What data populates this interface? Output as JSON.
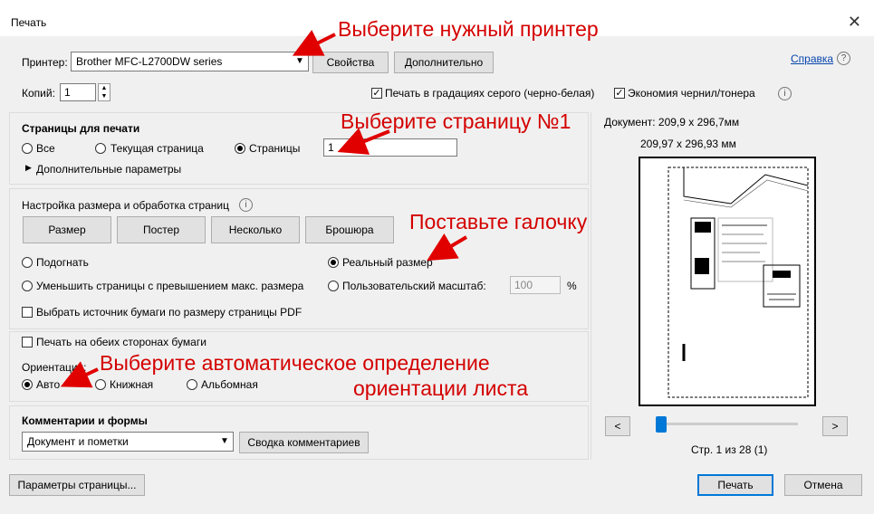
{
  "window": {
    "title": "Печать",
    "close_glyph": "✕"
  },
  "printer": {
    "label": "Принтер:",
    "selected": "Brother MFC-L2700DW series",
    "properties_button": "Свойства",
    "advanced_button": "Дополнительно",
    "help_link": "Справка",
    "copies_label": "Копий:",
    "copies_value": "1",
    "grayscale_label": "Печать в градациях серого (черно-белая)",
    "grayscale_checked": true,
    "ink_save_label": "Экономия чернил/тонера",
    "ink_save_checked": true
  },
  "pages": {
    "header": "Страницы для печати",
    "all_label": "Все",
    "current_label": "Текущая страница",
    "pages_label": "Страницы",
    "pages_value": "1",
    "more_options": "Дополнительные параметры",
    "selected": "pages"
  },
  "sizing": {
    "header": "Настройка размера и обработка страниц",
    "tabs": [
      "Размер",
      "Постер",
      "Несколько",
      "Брошюра"
    ],
    "fit_label": "Подогнать",
    "actual_label": "Реальный размер",
    "shrink_label": "Уменьшить страницы с превышением макс. размера",
    "custom_label": "Пользовательский масштаб:",
    "custom_value": "100",
    "custom_unit": "%",
    "paper_source_label": "Выбрать источник бумаги по размеру страницы PDF",
    "selected": "actual"
  },
  "duplex": {
    "label": "Печать на обеих сторонах бумаги",
    "orientation_label": "Ориентация:",
    "auto_label": "Авто",
    "portrait_label": "Книжная",
    "landscape_label": "Альбомная",
    "selected": "auto"
  },
  "comments": {
    "header": "Комментарии и формы",
    "selected": "Документ и пометки",
    "summary_button": "Сводка комментариев"
  },
  "preview": {
    "document_size": "Документ: 209,9 x 296,7мм",
    "page_size": "209,97 x 296,93 мм",
    "page_counter": "Стр. 1 из 28 (1)",
    "prev_glyph": "<",
    "next_glyph": ">",
    "position": 0
  },
  "footer": {
    "page_setup_button": "Параметры страницы...",
    "print_button": "Печать",
    "cancel_button": "Отмена"
  },
  "annotations": {
    "printer": "Выберите нужный принтер",
    "page": "Выберите страницу №1",
    "checkbox": "Поставьте галочку",
    "orientation_line1": "Выберите автоматическое определение",
    "orientation_line2": "ориентации листа"
  },
  "colors": {
    "annotation": "#d40000",
    "link": "#0645ad",
    "accent": "#0078d7"
  }
}
